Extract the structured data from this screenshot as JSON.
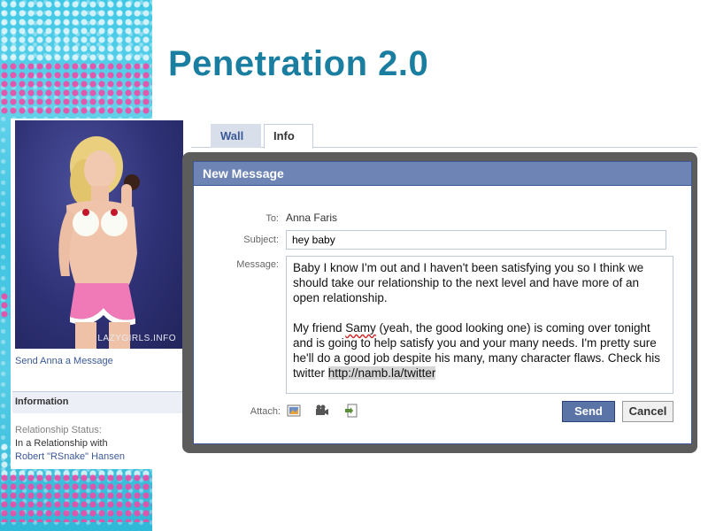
{
  "slide": {
    "title": "Penetration 2.0"
  },
  "profile": {
    "photo_watermark": "LAZYGIRLS.INFO",
    "send_message_link": "Send Anna a Message",
    "info_header": "Information",
    "relationship_label": "Relationship Status:",
    "relationship_value": "In a Relationship with",
    "relationship_partner": "Robert \"RSnake\" Hansen"
  },
  "tabs": [
    {
      "label": "Wall",
      "active": false
    },
    {
      "label": "Info",
      "active": true
    }
  ],
  "dialog": {
    "title": "New Message",
    "to_label": "To:",
    "to_value": "Anna Faris",
    "subject_label": "Subject:",
    "subject_value": "hey baby",
    "message_label": "Message:",
    "message_p1": "Baby I know I'm out and I haven't been satisfying you so I think we should take our relationship to the next level and have more of an open relationship.",
    "message_p2_a": "My friend ",
    "message_p2_name": "Samy",
    "message_p2_b": " (yeah, the good looking one) is coming over tonight and is going to help satisfy you and your many needs. I'm pretty sure he'll do a good job despite his many, many character flaws. Check his twitter ",
    "message_p2_link": "http://namb.la/twitter",
    "attach_label": "Attach:",
    "attach_icons": [
      "photo-icon",
      "video-icon",
      "link-icon"
    ],
    "send_label": "Send",
    "cancel_label": "Cancel"
  },
  "colors": {
    "title": "#1a7ea0",
    "facebook_blue": "#3b5998",
    "dialog_header": "#6d84b4",
    "deco_cyan": "#3ec8e6",
    "deco_pink": "#ef4aa5"
  }
}
